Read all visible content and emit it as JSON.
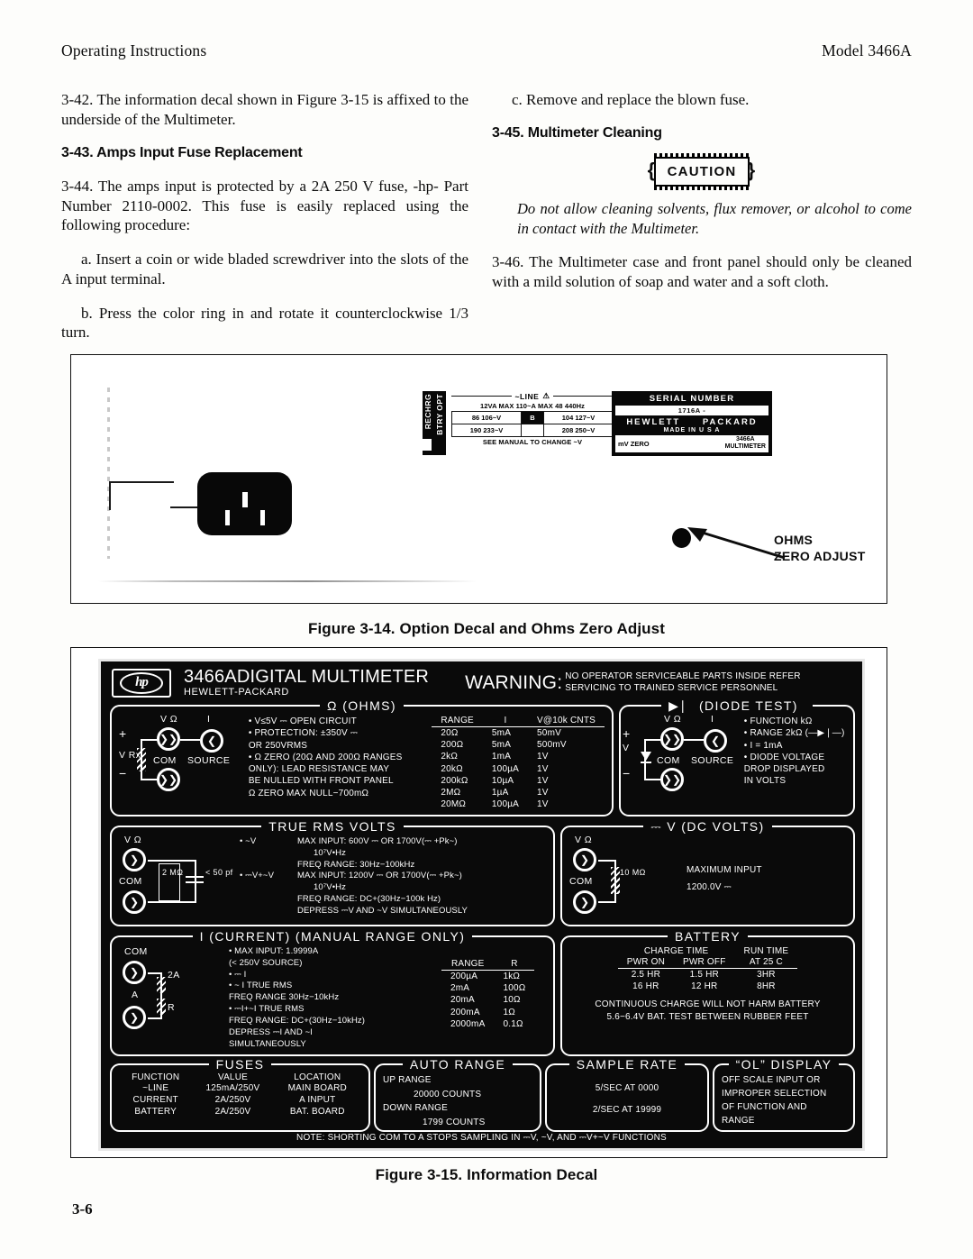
{
  "runhead": {
    "left": "Operating Instructions",
    "right": "Model 3466A"
  },
  "body": {
    "p342": "3-42.  The information decal shown in Figure 3-15 is affixed to the underside of the Multimeter.",
    "h343": "3-43. Amps Input Fuse Replacement",
    "p344": "3-44.  The amps input is protected by a 2A 250 V fuse, -hp- Part Number 2110-0002. This fuse is easily replaced using the following procedure:",
    "pa": "a.  Insert a coin or wide bladed screwdriver into the slots of the A input terminal.",
    "pb": "b.  Press the color ring in and rotate it counterclockwise 1/3 turn.",
    "pc": "c.  Remove and replace the blown fuse.",
    "h345": "3-45. Multimeter Cleaning",
    "caution_label": "CAUTION",
    "caution_text": "Do not allow cleaning solvents, flux remover, or alcohol to come in contact with the Multimeter.",
    "p346": "3-46.  The Multimeter case and front panel should only be cleaned with a mild solution of soap and water and a soft cloth."
  },
  "figure14": {
    "caption": "Figure 3-14.  Option Decal and Ohms Zero Adjust",
    "callout": {
      "line1": "OHMS",
      "line2": "ZERO ADJUST"
    },
    "rechrg": {
      "line1": "RECHRG",
      "line2": "BTRY OPT"
    },
    "line_decal": {
      "title": "~LINE",
      "title_symbol": "⚠",
      "subtitle": "12VA MAX 110~A MAX  48 440Hz",
      "rows": [
        {
          "left": "86 106~V",
          "mid": "B",
          "right": "104 127~V"
        },
        {
          "left": "190 233~V",
          "mid": "",
          "right": "208 250~V"
        }
      ],
      "footer": "SEE MANUAL TO CHANGE ~V"
    },
    "serial_plate": {
      "header": "SERIAL NUMBER",
      "serial": "1716A -",
      "brand_left": "HEWLETT",
      "brand_right": "PACKARD",
      "made": "MADE IN U S A",
      "bottom_left": "mV ZERO",
      "bottom_right_1": "3466A",
      "bottom_right_2": "MULTIMETER"
    }
  },
  "figure15": {
    "caption": "Figure 3-15.  Information Decal",
    "header": {
      "logo": "hp",
      "model": "3466ADIGITAL MULTIMETER",
      "brand": "HEWLETT-PACKARD",
      "warning_label": "WARNING:",
      "warning_line1": "NO OPERATOR SERVICEABLE PARTS INSIDE  REFER",
      "warning_line2": "SERVICING TO TRAINED SERVICE PERSONNEL"
    },
    "ohms": {
      "legend": "Ω (OHMS)",
      "terminals": {
        "v_omega": "V Ω",
        "i": "I",
        "source": "SOURCE",
        "com": "COM",
        "vrx": "V Rx",
        "plus": "+",
        "minus": "−"
      },
      "bullets": [
        "• V≤5V ⎓ OPEN CIRCUIT",
        "• PROTECTION: ±350V ⎓",
        "    OR 250VRMS",
        "• Ω ZERO (20Ω AND 200Ω RANGES",
        "      ONLY): LEAD RESISTANCE MAY",
        "      BE NULLED WITH FRONT PANEL",
        "      Ω ZERO MAX NULL−700mΩ"
      ],
      "table": {
        "headers": [
          "RANGE",
          "I",
          "V@10k CNTS"
        ],
        "rows": [
          [
            "20Ω",
            "5mA",
            "50mV"
          ],
          [
            "200Ω",
            "5mA",
            "500mV"
          ],
          [
            "2kΩ",
            "1mA",
            "1V"
          ],
          [
            "20kΩ",
            "100µA",
            "1V"
          ],
          [
            "200kΩ",
            "10µA",
            "1V"
          ],
          [
            "2MΩ",
            "1µA",
            "1V"
          ],
          [
            "20MΩ",
            "100µA",
            "1V"
          ]
        ]
      }
    },
    "diode": {
      "legend": "(DIODE TEST)",
      "terminals": {
        "v_omega": "V Ω",
        "i": "I",
        "source": "SOURCE",
        "com": "COM",
        "v": "V",
        "plus": "+",
        "minus": "−"
      },
      "bullets": [
        "• FUNCTION kΩ",
        "• RANGE  2kΩ (—▶❘—)",
        "• I = 1mA",
        "• DIODE VOLTAGE",
        "   DROP DISPLAYED",
        "   IN VOLTS"
      ]
    },
    "trms": {
      "legend": "TRUE RMS VOLTS",
      "terminals": {
        "v_omega": "V Ω",
        "com": "COM",
        "res": "2 MΩ",
        "cap": "< 50 pf"
      },
      "rows": [
        {
          "label": "• ~V",
          "lines": [
            "MAX INPUT: 600V ⎓ OR 1700V(⎓ +Pk~)",
            "10⁷V•Hz",
            "FREQ RANGE: 30Hz−100kHz"
          ]
        },
        {
          "label": "• ⎓V+~V",
          "lines": [
            "MAX INPUT: 1200V ⎓ OR 1700V(⎓ +Pk~)",
            "10⁷V•Hz",
            "FREQ RANGE: DC+(30Hz−100k Hz)",
            "DEPRESS ⎓V AND ~V SIMULTANEOUSLY"
          ]
        }
      ]
    },
    "dcvolts": {
      "legend": "⎓ V (DC VOLTS)",
      "terminals": {
        "v_omega": "V Ω",
        "com": "COM",
        "res": "10 MΩ"
      },
      "line1": "MAXIMUM INPUT",
      "line2": "1200.0V ⎓"
    },
    "current": {
      "legend": "I (CURRENT) (MANUAL RANGE ONLY)",
      "terminals": {
        "com": "COM",
        "a": "A",
        "fuse": "2A",
        "r": "R"
      },
      "bullets": [
        "•        MAX INPUT: 1.9999A",
        "         (< 250V SOURCE)",
        "• ⎓ I",
        "• ~ I  TRUE RMS",
        "        FREQ RANGE 30Hz−10kHz",
        "• ⎓I+~I TRUE RMS",
        "        FREQ RANGE: DC+(30Hz−10kHz)",
        "        DEPRESS ⎓I AND ~I",
        "        SIMULTANEOUSLY"
      ],
      "table": {
        "headers": [
          "RANGE",
          "R"
        ],
        "rows": [
          [
            "200µA",
            "1kΩ"
          ],
          [
            "2mA",
            "100Ω"
          ],
          [
            "20mA",
            "10Ω"
          ],
          [
            "200mA",
            "1Ω"
          ],
          [
            "2000mA",
            "0.1Ω"
          ]
        ]
      }
    },
    "battery": {
      "legend": "BATTERY",
      "group_headers": [
        "CHARGE TIME",
        "RUN TIME"
      ],
      "headers": [
        "PWR ON",
        "PWR OFF",
        "AT 25 C"
      ],
      "rows": [
        [
          "2.5 HR",
          "1.5 HR",
          "3HR"
        ],
        [
          "16 HR",
          "12 HR",
          "8HR"
        ]
      ],
      "note1": "CONTINUOUS CHARGE WILL NOT HARM BATTERY",
      "note2": "5.6−6.4V BAT. TEST BETWEEN RUBBER FEET"
    },
    "fuses": {
      "legend": "FUSES",
      "headers": [
        "FUNCTION",
        "VALUE",
        "LOCATION"
      ],
      "rows": [
        [
          "~LINE",
          "125mA/250V",
          "MAIN BOARD"
        ],
        [
          "CURRENT",
          "2A/250V",
          "A INPUT"
        ],
        [
          "BATTERY",
          "2A/250V",
          "BAT. BOARD"
        ]
      ]
    },
    "autorange": {
      "legend": "AUTO RANGE",
      "rows": [
        {
          "label": "UP RANGE",
          "value": "20000 COUNTS"
        },
        {
          "label": "DOWN RANGE",
          "value": "1799 COUNTS"
        }
      ]
    },
    "samplerate": {
      "legend": "SAMPLE RATE",
      "lines": [
        "5/SEC AT 0000",
        "2/SEC AT 19999"
      ]
    },
    "oldisplay": {
      "legend": "“OL” DISPLAY",
      "lines": [
        "OFF SCALE INPUT OR",
        "IMPROPER SELECTION",
        "OF FUNCTION AND",
        "RANGE"
      ]
    },
    "note": "NOTE: SHORTING COM TO A STOPS SAMPLING IN ⎓V, ~V, AND ⎓V+~V FUNCTIONS"
  },
  "pagenum": "3-6"
}
